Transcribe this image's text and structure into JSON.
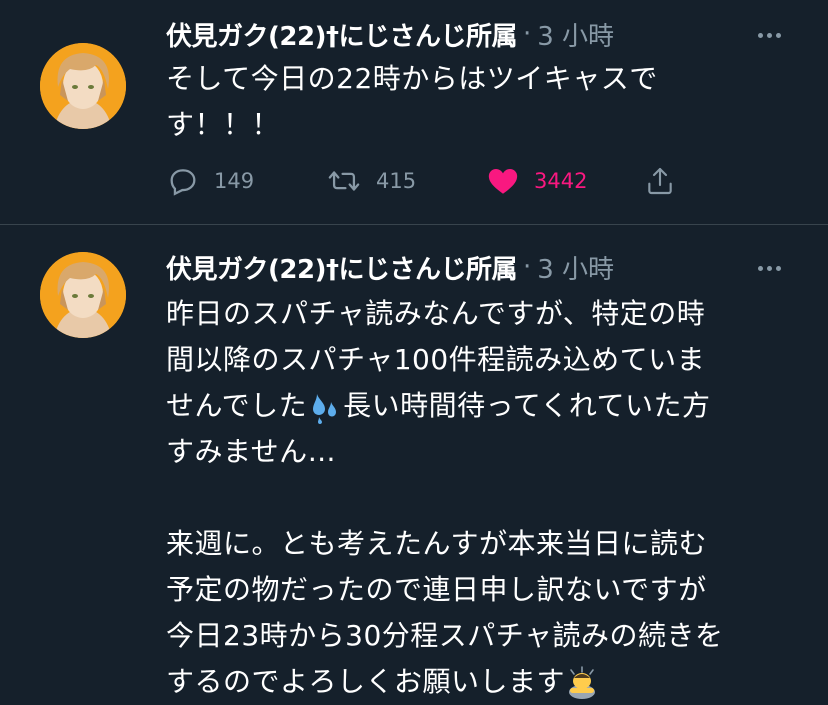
{
  "tweets": [
    {
      "author": "伏見ガク(22)†にじさんじ所属",
      "separator": "·",
      "time": "3 小時",
      "text_lines": [
        "そして今日の22時からはツイキャスで",
        "す！！！"
      ],
      "actions": {
        "replies": "149",
        "retweets": "415",
        "likes": "3442"
      }
    },
    {
      "author": "伏見ガク(22)†にじさんじ所属",
      "separator": "·",
      "time": "3 小時",
      "text_lines": [
        "昨日のスパチャ読みなんですが、特定の時",
        "間以降のスパチャ100件程読み込めていま",
        "せんでした",
        "長い時間待ってくれていた方",
        "すみません…",
        "",
        "来週に。とも考えたんすが本来当日に読む",
        "予定の物だったので連日申し訳ないですが",
        "今日23時から30分程スパチャ読みの続きを",
        "するのでよろしくお願いします"
      ]
    }
  ],
  "colors": {
    "background": "#15202b",
    "muted": "#8899a6",
    "like": "#f91880",
    "divider": "#38444d"
  },
  "icons": [
    "more-icon",
    "reply-icon",
    "retweet-icon",
    "heart-icon",
    "share-icon",
    "sweat-droplets-emoji",
    "bowing-person-emoji"
  ]
}
